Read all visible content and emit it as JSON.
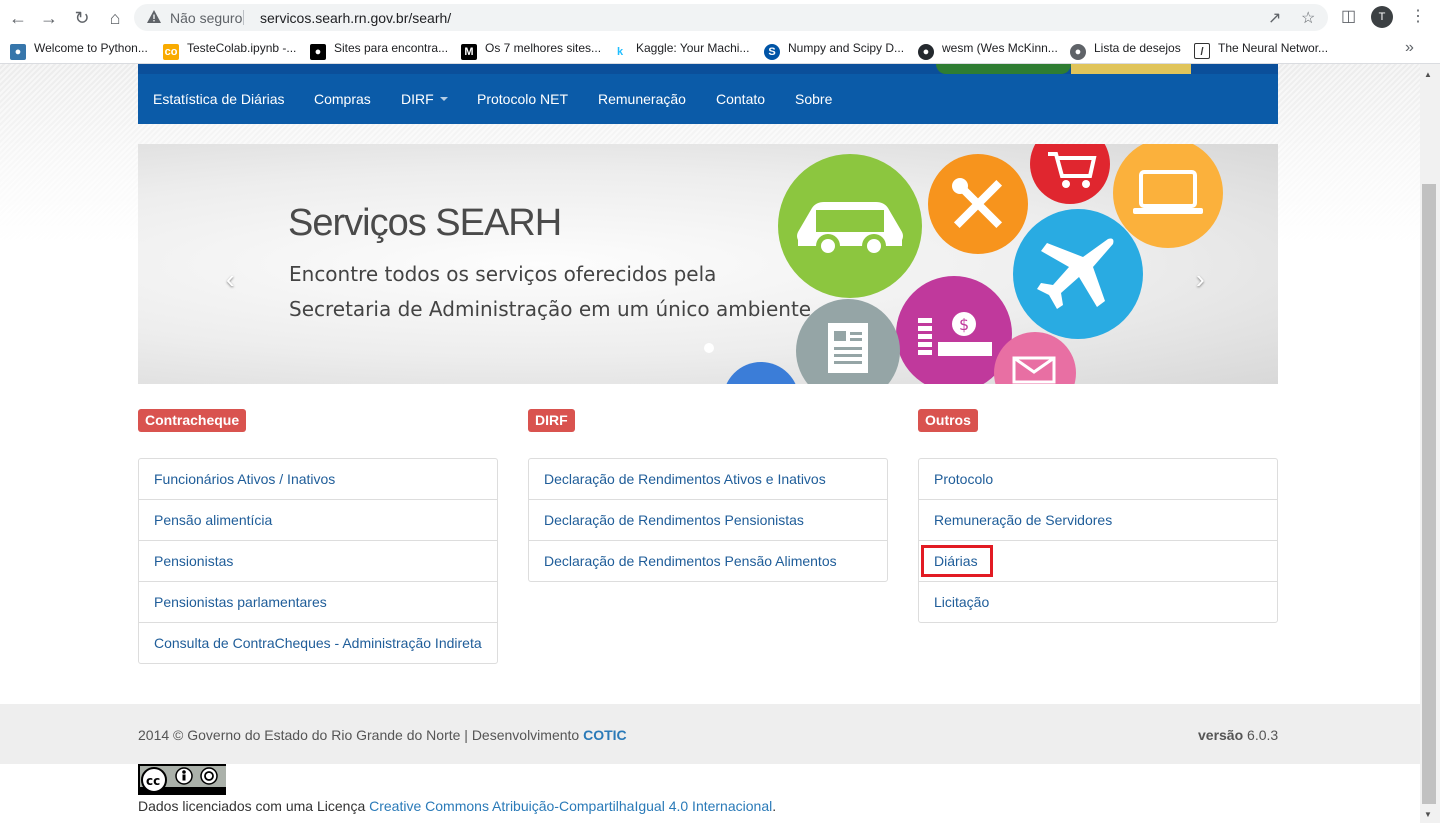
{
  "browser": {
    "security_label": "Não seguro",
    "url": "servicos.searh.rn.gov.br/searh/",
    "profile_initial": "T",
    "bookmarks": [
      {
        "label": "Welcome to Python...",
        "icon": "python-icon",
        "color": "#3776ab"
      },
      {
        "label": "TesteColab.ipynb -...",
        "icon": "colab-icon",
        "color": "#f9ab00"
      },
      {
        "label": "Sites para encontra...",
        "icon": "medium-icon",
        "color": "#000000"
      },
      {
        "label": "Os 7 melhores sites...",
        "icon": "medium-m-icon",
        "color": "#000000"
      },
      {
        "label": "Kaggle: Your Machi...",
        "icon": "kaggle-icon",
        "color": "#20beff"
      },
      {
        "label": "Numpy and Scipy D...",
        "icon": "scipy-icon",
        "color": "#0054a6"
      },
      {
        "label": "wesm (Wes McKinn...",
        "icon": "github-icon",
        "color": "#24292e"
      },
      {
        "label": "Lista de desejos",
        "icon": "globe-icon",
        "color": "#5f6368"
      },
      {
        "label": "The Neural Networ...",
        "icon": "page-icon",
        "color": "#333333"
      }
    ]
  },
  "navbar": {
    "items": [
      "Estatística de Diárias",
      "Compras",
      "DIRF",
      "Protocolo NET",
      "Remuneração",
      "Contato",
      "Sobre"
    ]
  },
  "carousel": {
    "title": "Serviços SEARH",
    "line1": "Encontre todos os serviços oferecidos pela",
    "line2": "Secretaria de Administração em um único ambiente.",
    "prev_glyph": "‹",
    "next_glyph": "›",
    "circle_colors": [
      "#8cc63f",
      "#f7941d",
      "#e0262f",
      "#fbb13c",
      "#29abe2",
      "#c0399c",
      "#95a5a6",
      "#e86fa3",
      "#3b7dd8"
    ]
  },
  "sections": {
    "contracheque": {
      "label": "Contracheque",
      "items": [
        "Funcionários Ativos / Inativos",
        "Pensão alimentícia",
        "Pensionistas",
        "Pensionistas parlamentares",
        "Consulta de ContraCheques - Administração Indireta"
      ]
    },
    "dirf": {
      "label": "DIRF",
      "items": [
        "Declaração de Rendimentos Ativos e Inativos",
        "Declaração de Rendimentos Pensionistas",
        "Declaração de Rendimentos Pensão Alimentos"
      ]
    },
    "outros": {
      "label": "Outros",
      "items": [
        "Protocolo",
        "Remuneração de Servidores",
        "Diárias",
        "Licitação"
      ]
    }
  },
  "footer": {
    "left_text": "2014 © Governo do Estado do Rio Grande do Norte | Desenvolvimento ",
    "left_link": "COTIC",
    "version_label": "versão",
    "version_value": "6.0.3"
  },
  "license": {
    "prefix": "Dados licenciados com uma Licença ",
    "link": "Creative Commons Atribuição-CompartilhaIgual 4.0 Internacional",
    "suffix": "."
  }
}
